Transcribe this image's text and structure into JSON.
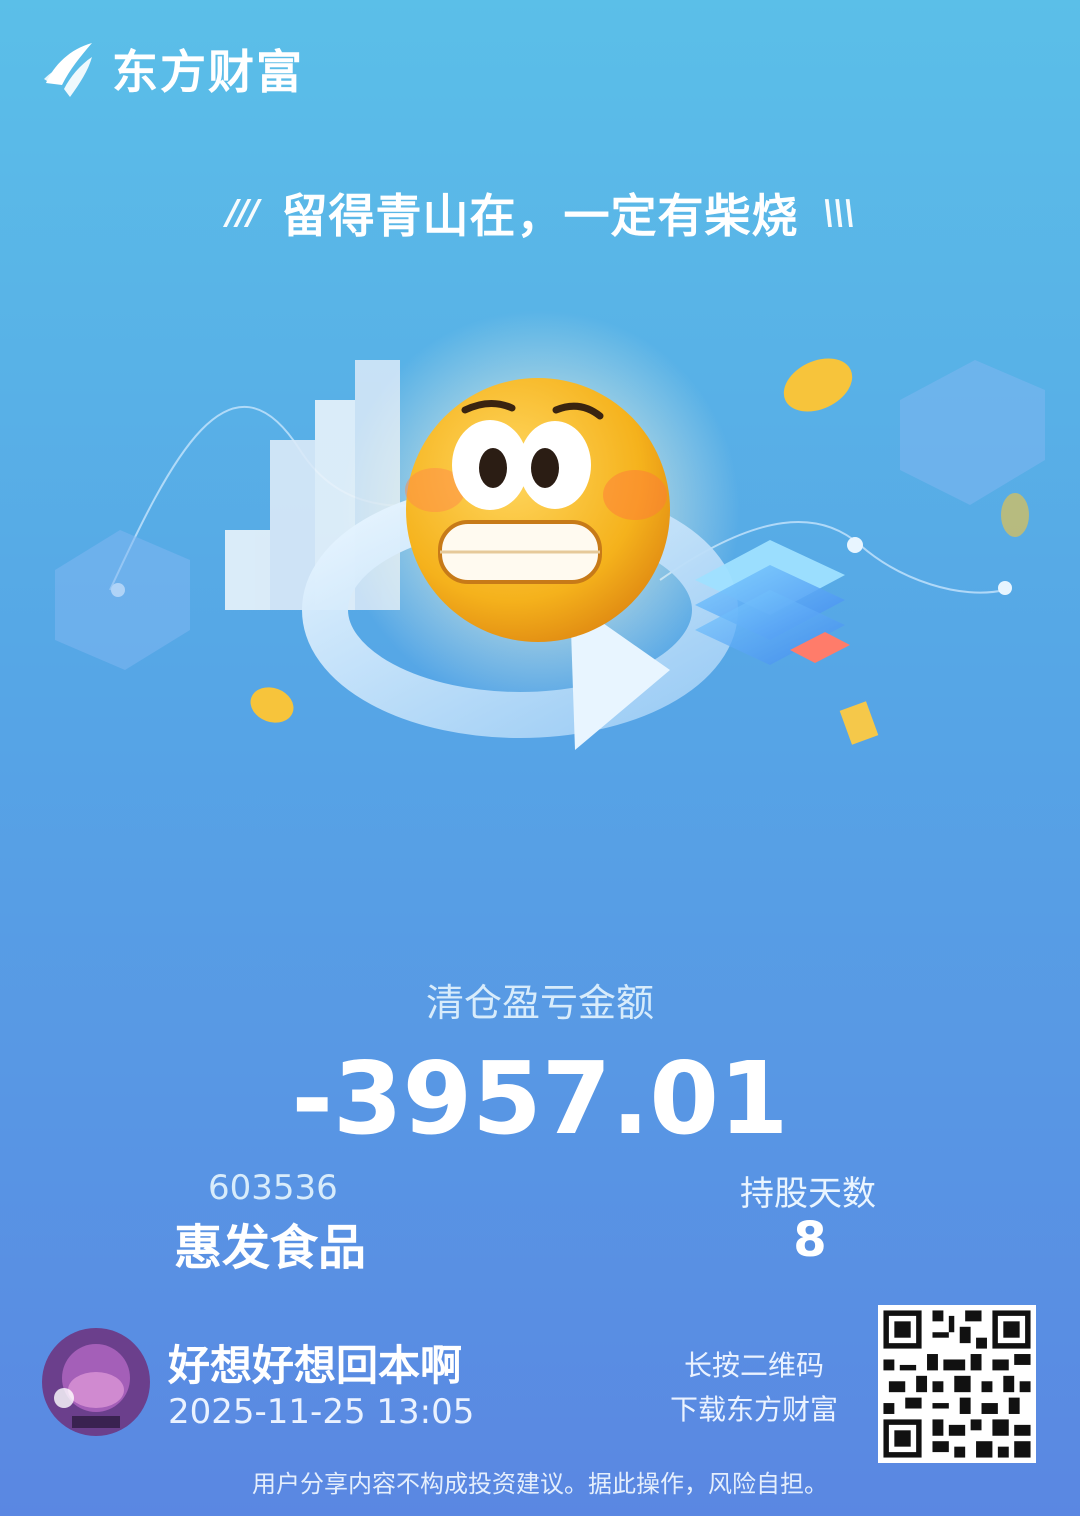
{
  "brand": {
    "name": "东方财富",
    "logo_icon": "eastmoney-sail-logo"
  },
  "slogan": {
    "text": "留得青山在，一定有柴烧",
    "left_deco": "///",
    "right_deco": "\\\\\\"
  },
  "illustration": {
    "emoji": "grimacing-face-emoji",
    "theme_color": "#f5b21c"
  },
  "result": {
    "label": "清仓盈亏金额",
    "amount": "-3957.01"
  },
  "stock": {
    "code": "603536",
    "name": "惠发食品"
  },
  "holding": {
    "label": "持股天数",
    "days": "8"
  },
  "user": {
    "name": "好想好想回本啊",
    "datetime": "2025-11-25 13:05",
    "avatar_icon": "game-avatar"
  },
  "qr": {
    "hint_line1": "长按二维码",
    "hint_line2": "下载东方财富"
  },
  "disclaimer": "用户分享内容不构成投资建议。据此操作，风险自担。"
}
